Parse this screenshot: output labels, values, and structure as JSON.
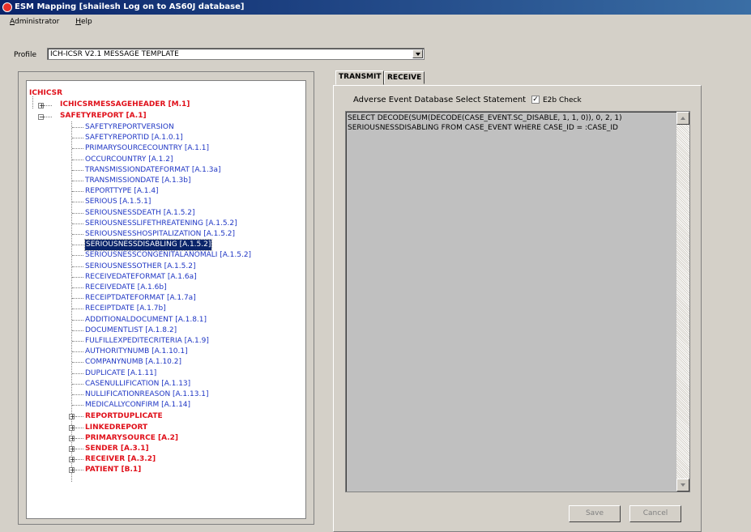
{
  "window": {
    "title": "ESM Mapping [shailesh Log on to AS60J database]"
  },
  "menu": {
    "items": [
      "Administrator",
      "Help"
    ]
  },
  "profile": {
    "label": "Profile",
    "value": "ICH-ICSR V2.1 MESSAGE TEMPLATE"
  },
  "tree": {
    "root": "ICHICSR",
    "level1": [
      "ICHICSRMESSAGEHEADER [M.1]",
      "SAFETYREPORT [A.1]"
    ],
    "safetyreport_children": [
      "SAFETYREPORTVERSION",
      "SAFETYREPORTID [A.1.0.1]",
      "PRIMARYSOURCECOUNTRY [A.1.1]",
      "OCCURCOUNTRY [A.1.2]",
      "TRANSMISSIONDATEFORMAT [A.1.3a]",
      "TRANSMISSIONDATE [A.1.3b]",
      "REPORTTYPE [A.1.4]",
      "SERIOUS [A.1.5.1]",
      "SERIOUSNESSDEATH [A.1.5.2]",
      "SERIOUSNESSLIFETHREATENING [A.1.5.2]",
      "SERIOUSNESSHOSPITALIZATION [A.1.5.2]",
      "SERIOUSNESSDISABLING [A.1.5.2]",
      "SERIOUSNESSCONGENITALANOMALI [A.1.5.2]",
      "SERIOUSNESSOTHER [A.1.5.2]",
      "RECEIVEDATEFORMAT [A.1.6a]",
      "RECEIVEDATE [A.1.6b]",
      "RECEIPTDATEFORMAT [A.1.7a]",
      "RECEIPTDATE [A.1.7b]",
      "ADDITIONALDOCUMENT [A.1.8.1]",
      "DOCUMENTLIST [A.1.8.2]",
      "FULFILLEXPEDITECRITERIA [A.1.9]",
      "AUTHORITYNUMB [A.1.10.1]",
      "COMPANYNUMB [A.1.10.2]",
      "DUPLICATE [A.1.11]",
      "CASENULLIFICATION [A.1.13]",
      "NULLIFICATIONREASON [A.1.13.1]",
      "MEDICALLYCONFIRM [A.1.14]"
    ],
    "safetyreport_groups": [
      "REPORTDUPLICATE",
      "LINKEDREPORT",
      "PRIMARYSOURCE [A.2]",
      "SENDER [A.3.1]",
      "RECEIVER [A.3.2]",
      "PATIENT [B.1]"
    ],
    "selected": "SERIOUSNESSDISABLING [A.1.5.2]"
  },
  "tabs": {
    "transmit": "TRANSMIT",
    "receive": "RECEIVE"
  },
  "transmit": {
    "statement_label": "Adverse Event Database Select Statement",
    "e2b_check_label": "E2b Check",
    "e2b_checked": true,
    "sql": "SELECT DECODE(SUM(DECODE(CASE_EVENT.SC_DISABLE, 1, 1, 0)), 0, 2, 1)\nSERIOUSNESSDISABLING FROM CASE_EVENT WHERE CASE_ID = :CASE_ID",
    "save_label": "Save",
    "cancel_label": "Cancel"
  }
}
